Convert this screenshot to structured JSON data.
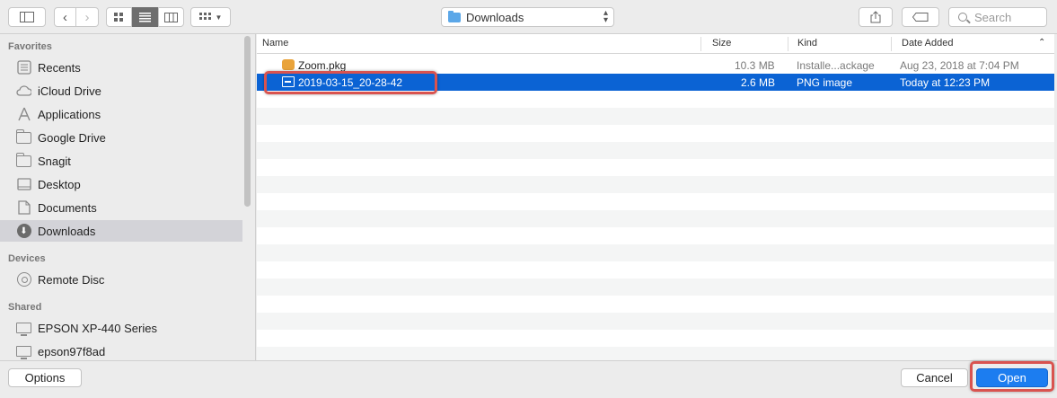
{
  "toolbar": {
    "location": "Downloads",
    "search_placeholder": "Search"
  },
  "sidebar": {
    "sections": [
      {
        "title": "Favorites",
        "items": [
          {
            "label": "Recents",
            "icon": "clock-icon"
          },
          {
            "label": "iCloud Drive",
            "icon": "cloud-icon"
          },
          {
            "label": "Applications",
            "icon": "applications-icon"
          },
          {
            "label": "Google Drive",
            "icon": "folder-icon"
          },
          {
            "label": "Snagit",
            "icon": "folder-icon"
          },
          {
            "label": "Desktop",
            "icon": "desktop-icon"
          },
          {
            "label": "Documents",
            "icon": "documents-icon"
          },
          {
            "label": "Downloads",
            "icon": "downloads-icon",
            "selected": true
          }
        ]
      },
      {
        "title": "Devices",
        "items": [
          {
            "label": "Remote Disc",
            "icon": "disc-icon"
          }
        ]
      },
      {
        "title": "Shared",
        "items": [
          {
            "label": "EPSON XP-440 Series",
            "icon": "monitor-icon"
          },
          {
            "label": "epson97f8ad",
            "icon": "monitor-icon"
          }
        ]
      }
    ]
  },
  "columns": {
    "name": "Name",
    "size": "Size",
    "kind": "Kind",
    "date_added": "Date Added"
  },
  "files": [
    {
      "name": "Zoom.pkg",
      "size": "10.3 MB",
      "kind": "Installe...ackage",
      "date_added": "Aug 23, 2018 at 7:04 PM",
      "icon": "package-icon"
    },
    {
      "name": "2019-03-15_20-28-42",
      "size": "2.6 MB",
      "kind": "PNG image",
      "date_added": "Today at 12:23 PM",
      "icon": "image-icon",
      "selected": true
    }
  ],
  "buttons": {
    "options": "Options",
    "cancel": "Cancel",
    "open": "Open"
  },
  "colors": {
    "selection": "#0b63d4",
    "highlight_box": "#d9534f",
    "primary_button": "#1c7df0"
  }
}
